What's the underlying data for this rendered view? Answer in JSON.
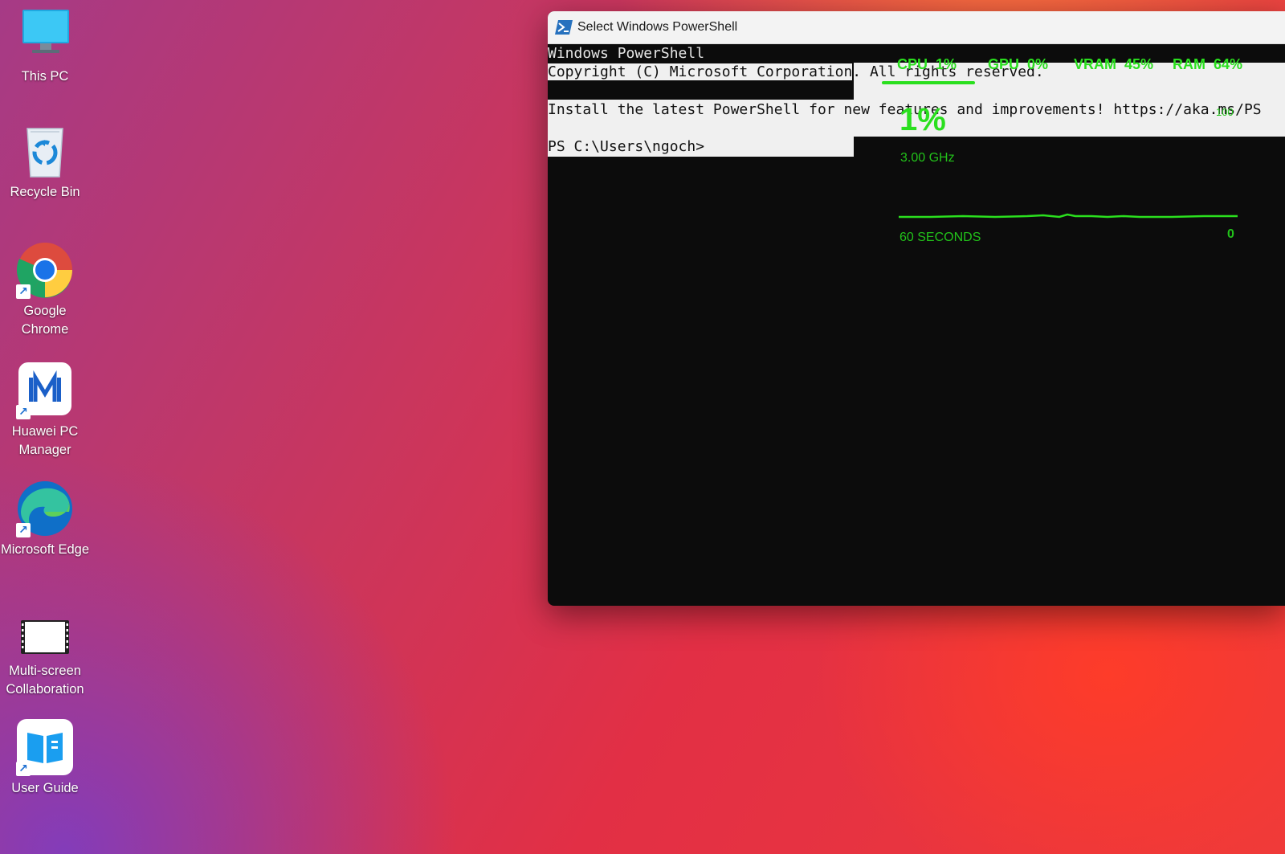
{
  "desktop": {
    "icons": [
      {
        "label": "This PC",
        "icon": "computer-monitor-icon"
      },
      {
        "label": "Recycle Bin",
        "icon": "recycle-bin-icon"
      },
      {
        "label": "Google Chrome",
        "icon": "chrome-icon"
      },
      {
        "label": "Huawei PC Manager",
        "icon": "huawei-pc-manager-icon"
      },
      {
        "label": "Microsoft Edge",
        "icon": "edge-icon"
      },
      {
        "label": "Multi-screen Collaboration",
        "icon": "multi-screen-icon"
      },
      {
        "label": "User Guide",
        "icon": "user-guide-icon"
      }
    ]
  },
  "powershell": {
    "title": "Select Windows PowerShell",
    "lines": [
      "Windows PowerShell",
      "Copyright (C) Microsoft Corporation",
      ". All rights reserved.",
      "Install the latest PowerShell for new features and improvements! https://aka.ms/PS",
      "PS C:\\Users\\ngoch>"
    ]
  },
  "overlay": {
    "cpu": "CPU  1%",
    "gpu": "GPU  0%",
    "vram": "VRAM  45%",
    "ram": "RAM  64%",
    "big_value": "1%",
    "top_scale": "100",
    "frequency": "3.00 GHz",
    "window_label": "60 SECONDS",
    "bottom_scale": "0",
    "accent_color": "#2adf1e"
  }
}
